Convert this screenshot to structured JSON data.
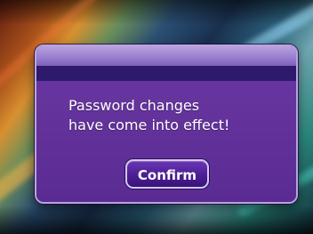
{
  "dialog": {
    "message_lines": [
      "Password changes",
      "have come into effect!"
    ],
    "confirm_label": "Confirm"
  },
  "colors": {
    "dialog_fill": "#5c2e95",
    "dialog_header": "#9a80cf",
    "dialog_band": "#2e1a6c",
    "dialog_border": "#b9a3df",
    "button_fill": "#4b1e93",
    "button_border": "#d6c6f3",
    "text": "#ffffff"
  }
}
